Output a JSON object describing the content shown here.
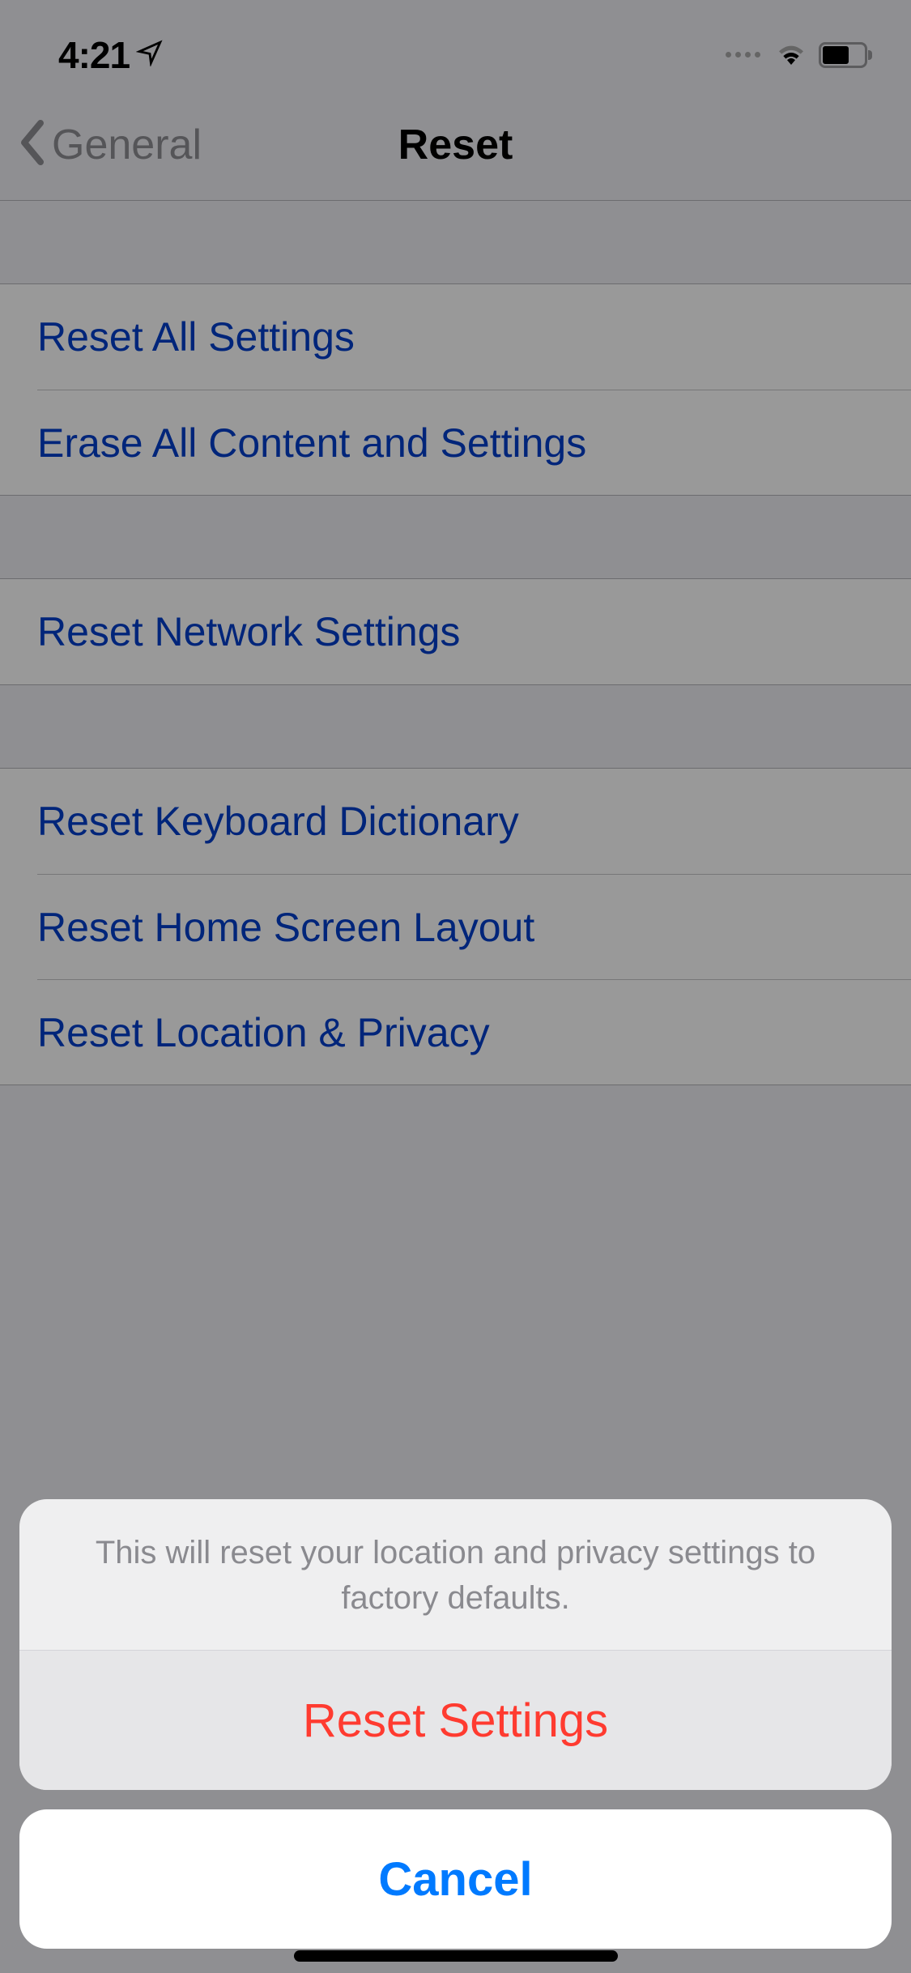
{
  "status": {
    "time": "4:21"
  },
  "nav": {
    "back_label": "General",
    "title": "Reset"
  },
  "rows": {
    "reset_all": "Reset All Settings",
    "erase_all": "Erase All Content and Settings",
    "reset_network": "Reset Network Settings",
    "reset_keyboard": "Reset Keyboard Dictionary",
    "reset_home": "Reset Home Screen Layout",
    "reset_location": "Reset Location & Privacy"
  },
  "sheet": {
    "message": "This will reset your location and privacy settings to factory defaults.",
    "action_label": "Reset Settings",
    "cancel_label": "Cancel"
  }
}
